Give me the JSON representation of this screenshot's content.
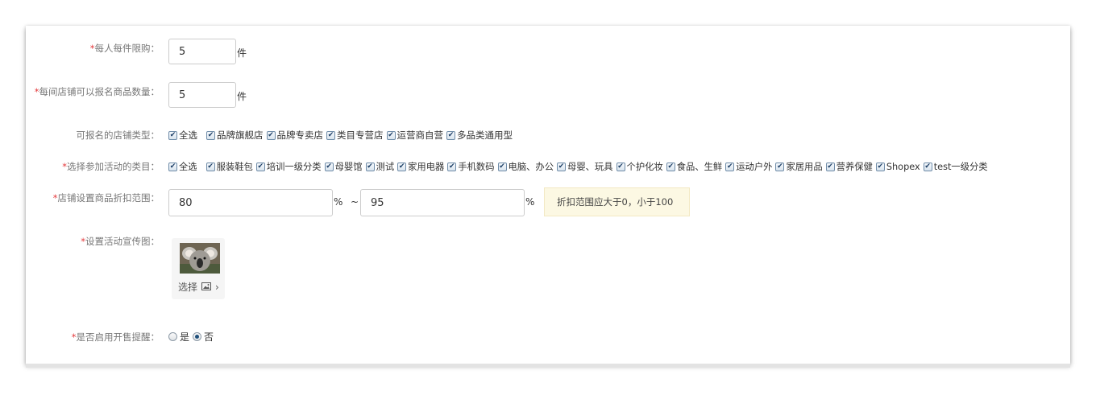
{
  "form": {
    "limit_per_person": {
      "required": "*",
      "label": "每人每件限购：",
      "value": "5",
      "unit": "件"
    },
    "store_goods_count": {
      "required": "*",
      "label": "每间店铺可以报名商品数量：",
      "value": "5",
      "unit": "件"
    },
    "store_types": {
      "label": "可报名的店铺类型：",
      "options": [
        {
          "label": "全选",
          "checked": true
        },
        {
          "label": "品牌旗舰店",
          "checked": true
        },
        {
          "label": "品牌专卖店",
          "checked": true
        },
        {
          "label": "类目专营店",
          "checked": true
        },
        {
          "label": "运营商自营",
          "checked": true
        },
        {
          "label": "多品类通用型",
          "checked": true
        }
      ]
    },
    "categories": {
      "required": "*",
      "label": "选择参加活动的类目：",
      "options": [
        {
          "label": "全选",
          "checked": true
        },
        {
          "label": "服装鞋包",
          "checked": true
        },
        {
          "label": "培训一级分类",
          "checked": true
        },
        {
          "label": "母婴馆",
          "checked": true
        },
        {
          "label": "测试",
          "checked": true
        },
        {
          "label": "家用电器",
          "checked": true
        },
        {
          "label": "手机数码",
          "checked": true
        },
        {
          "label": "电脑、办公",
          "checked": true
        },
        {
          "label": "母婴、玩具",
          "checked": true
        },
        {
          "label": "个护化妆",
          "checked": true
        },
        {
          "label": "食品、生鲜",
          "checked": true
        },
        {
          "label": "运动户外",
          "checked": true
        },
        {
          "label": "家居用品",
          "checked": true
        },
        {
          "label": "营养保健",
          "checked": true
        },
        {
          "label": "Shopex",
          "checked": true
        },
        {
          "label": "test一级分类",
          "checked": true
        }
      ]
    },
    "discount_range": {
      "required": "*",
      "label": "店铺设置商品折扣范围：",
      "min": "80",
      "max": "95",
      "unit": "%",
      "separator": "~",
      "hint": "折扣范围应大于0，小于100"
    },
    "promo_image": {
      "required": "*",
      "label": "设置活动宣传图：",
      "select_label": "选择",
      "image_icon": "image-icon",
      "chevron": "›"
    },
    "presale_reminder": {
      "required": "*",
      "label": "是否启用开售提醒：",
      "options": [
        {
          "label": "是",
          "selected": false
        },
        {
          "label": "否",
          "selected": true
        }
      ]
    }
  }
}
